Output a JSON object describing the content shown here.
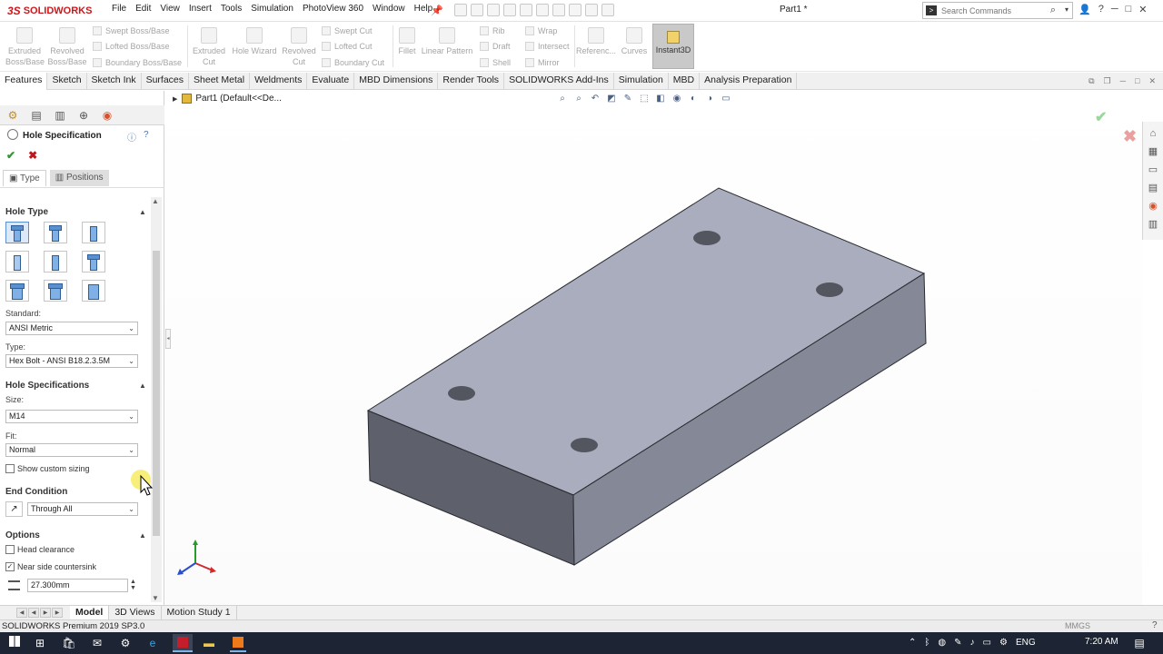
{
  "app": {
    "logo_ds": "3S",
    "logo_text": "SOLIDWORKS",
    "document_title": "Part1 *",
    "search_placeholder": "Search Commands",
    "menu": [
      "File",
      "Edit",
      "View",
      "Insert",
      "Tools",
      "Simulation",
      "PhotoView 360",
      "Window",
      "Help"
    ]
  },
  "ribbon": {
    "extruded_boss": "Extruded Boss/Base",
    "revolved_boss": "Revolved Boss/Base",
    "swept_boss": "Swept Boss/Base",
    "lofted_boss": "Lofted Boss/Base",
    "boundary_boss": "Boundary Boss/Base",
    "extruded_cut": "Extruded Cut",
    "hole_wizard": "Hole Wizard",
    "revolved_cut": "Revolved Cut",
    "swept_cut": "Swept Cut",
    "lofted_cut": "Lofted Cut",
    "boundary_cut": "Boundary Cut",
    "fillet": "Fillet",
    "linear_pattern": "Linear Pattern",
    "rib": "Rib",
    "draft": "Draft",
    "shell": "Shell",
    "wrap": "Wrap",
    "intersect": "Intersect",
    "mirror": "Mirror",
    "reference": "Referenc...",
    "curves": "Curves",
    "instant3d": "Instant3D"
  },
  "tabs": [
    "Features",
    "Sketch",
    "Sketch Ink",
    "Surfaces",
    "Sheet Metal",
    "Weldments",
    "Evaluate",
    "MBD Dimensions",
    "Render Tools",
    "SOLIDWORKS Add-Ins",
    "Simulation",
    "MBD",
    "Analysis Preparation"
  ],
  "property_manager": {
    "title": "Hole Specification",
    "type_tab": "Type",
    "positions_tab": "Positions",
    "hole_type_heading": "Hole Type",
    "standard_label": "Standard:",
    "standard_value": "ANSI Metric",
    "type_label": "Type:",
    "type_value": "Hex Bolt - ANSI B18.2.3.5M",
    "hole_specs_heading": "Hole Specifications",
    "size_label": "Size:",
    "size_value": "M14",
    "fit_label": "Fit:",
    "fit_value": "Normal",
    "custom_sizing_label": "Show custom sizing",
    "custom_sizing_checked": false,
    "end_condition_heading": "End Condition",
    "end_condition_value": "Through All",
    "options_heading": "Options",
    "head_clearance_label": "Head clearance",
    "head_clearance_checked": false,
    "near_countersink_label": "Near side countersink",
    "near_countersink_checked": true,
    "countersink_diameter": "27.300mm"
  },
  "graphics": {
    "tree_label": "Part1  (Default<<De...",
    "block_top_color": "#a9adbe",
    "block_front_color": "#5e616c",
    "block_side_color": "#858896"
  },
  "bottom_tabs": [
    "Model",
    "3D Views",
    "Motion Study 1"
  ],
  "status": {
    "left": "SOLIDWORKS Premium 2019 SP3.0",
    "units": "MMGS"
  },
  "taskbar": {
    "language": "ENG",
    "time": "7:20 AM"
  }
}
